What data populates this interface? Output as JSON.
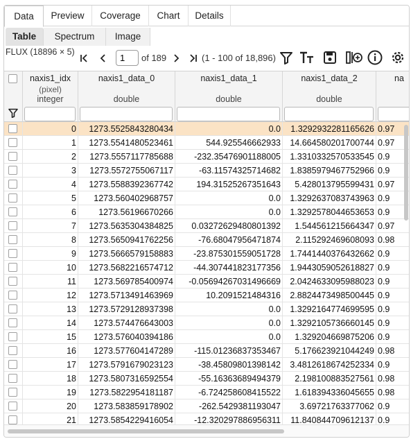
{
  "tabs": [
    "Data",
    "Preview",
    "Coverage",
    "Chart",
    "Details"
  ],
  "active_tab": "Data",
  "subtabs": [
    "Table",
    "Spectrum",
    "Image"
  ],
  "active_subtab": "Table",
  "toolbar": {
    "flux_label": "FLUX (18896 × 5)",
    "page_value": "1",
    "page_of": "of 189",
    "range_text": "(1 - 100 of 18,896)",
    "icons": [
      "first-page-icon",
      "prev-page-icon",
      "next-page-icon",
      "last-page-icon",
      "filter-icon",
      "text-format-icon",
      "save-icon",
      "add-column-icon",
      "info-icon",
      "settings-icon"
    ]
  },
  "columns": [
    {
      "name": "naxis1_idx",
      "unit": "(pixel)",
      "type": "integer"
    },
    {
      "name": "naxis1_data_0",
      "unit": "",
      "type": "double"
    },
    {
      "name": "naxis1_data_1",
      "unit": "",
      "type": "double"
    },
    {
      "name": "naxis1_data_2",
      "unit": "",
      "type": "double"
    },
    {
      "name": "na",
      "unit": "",
      "type": ""
    }
  ],
  "rows": [
    [
      "0",
      "1273.5525843280434",
      "0.0",
      "1.3292932281165626",
      "0.97"
    ],
    [
      "1",
      "1273.5541480523461",
      "544.925546662933",
      "14.664580201700744",
      "0.97"
    ],
    [
      "2",
      "1273.5557117785688",
      "-232.35476901188005",
      "1.3310332570533545",
      "0.9"
    ],
    [
      "3",
      "1273.5572755067117",
      "-63.11574325714682",
      "1.8385979467752966",
      "0.9"
    ],
    [
      "4",
      "1273.5588392367742",
      "194.31525267351643",
      "5.428013795599431",
      "0.97"
    ],
    [
      "5",
      "1273.560402968757",
      "0.0",
      "1.3292637083743963",
      "0.9"
    ],
    [
      "6",
      "1273.56196670266",
      "0.0",
      "1.3292578044653653",
      "0.9"
    ],
    [
      "7",
      "1273.5635304384825",
      "0.03272629480801392",
      "1.544561215664347",
      "0.97"
    ],
    [
      "8",
      "1273.5650941762256",
      "-76.68047956471874",
      "2.115292469608093",
      "0.98"
    ],
    [
      "9",
      "1273.5666579158883",
      "-23.875301559051728",
      "1.7441440376432662",
      "0.9"
    ],
    [
      "10",
      "1273.5682216574712",
      "-44.307441823177356",
      "1.9443059052618827",
      "0.9"
    ],
    [
      "11",
      "1273.569785400974",
      "-0.05694267031496669",
      "2.0424633095988023",
      "0.9"
    ],
    [
      "12",
      "1273.5713491463969",
      "10.2091521484316",
      "2.8824473498500445",
      "0.9"
    ],
    [
      "13",
      "1273.5729128937398",
      "0.0",
      "1.3292164774699595",
      "0.9"
    ],
    [
      "14",
      "1273.574476643003",
      "0.0",
      "1.3292105736660145",
      "0.9"
    ],
    [
      "15",
      "1273.576040394186",
      "0.0",
      "1.329204669875206",
      "0.9"
    ],
    [
      "16",
      "1273.577604147289",
      "-115.01236837353467",
      "5.176623921044249",
      "0.98"
    ],
    [
      "17",
      "1273.5791679023123",
      "-38.45809801398142",
      "3.4812618674252334",
      "0.9"
    ],
    [
      "18",
      "1273.5807316592554",
      "-55.16363689494379",
      "2.198100883527561",
      "0.98"
    ],
    [
      "19",
      "1273.5822954181187",
      "-6.724258608415522",
      "1.618394336045655",
      "0.98"
    ],
    [
      "20",
      "1273.583859178902",
      "-262.5429381193047",
      "3.69721763377062",
      "0.9"
    ],
    [
      "21",
      "1273.5854229416054",
      "-12.320297886956311",
      "11.840844709612137",
      "0.9"
    ]
  ],
  "colors": {
    "selected_row": "#fbe3c5",
    "header_bg": "#f4f4f4",
    "tab_active_bg": "#e3e3e3"
  }
}
